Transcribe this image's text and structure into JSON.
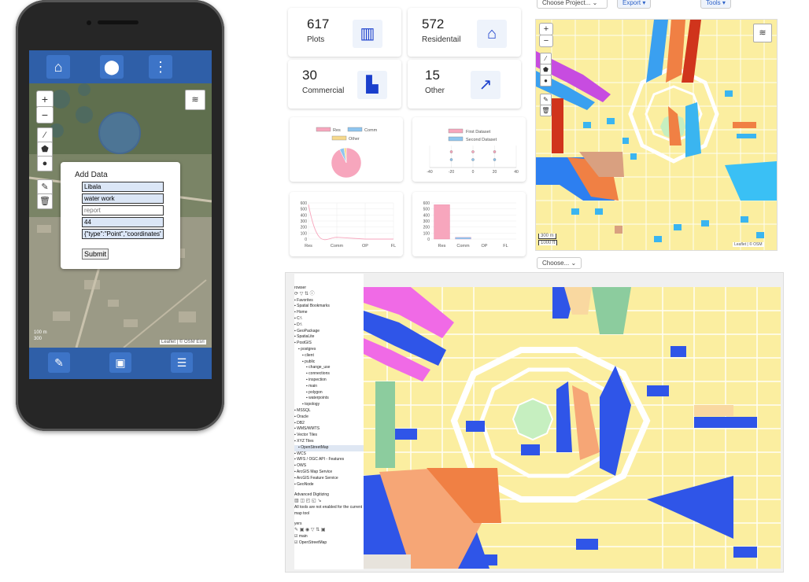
{
  "phone": {
    "form": {
      "title": "Add Data",
      "fields": [
        "Libala",
        "water work",
        "",
        "44",
        "{\"type\":\"Point\",\"coordinates\""
      ],
      "placeholder_report": "report",
      "submit_label": "Submit"
    },
    "map": {
      "zoom_in": "+",
      "zoom_out": "−",
      "scale_m": "100 m",
      "scale_ft": "300",
      "attribution": "Leaflet | © OSM  Esri"
    }
  },
  "dashboard": {
    "top_dropdowns": [
      "Choose Project...",
      "Export",
      "Tools"
    ],
    "stats": [
      {
        "value": "617",
        "label": "Plots"
      },
      {
        "value": "572",
        "label": "Residentail"
      },
      {
        "value": "30",
        "label": "Commercial"
      },
      {
        "value": "15",
        "label": "Other"
      }
    ],
    "bottom_dropdown": "Choose...",
    "map": {
      "zoom_in": "+",
      "zoom_out": "−",
      "scale_m": "300 m",
      "scale_ft": "1000 ft",
      "attribution": "Leaflet | © OSM"
    }
  },
  "chart_data": [
    {
      "type": "pie",
      "legend": [
        "Res",
        "Comm",
        "Other"
      ],
      "values": [
        572,
        30,
        15
      ],
      "colors": [
        "#f7a6bd",
        "#8ec5ef",
        "#f6d98c"
      ]
    },
    {
      "type": "scatter",
      "legend": [
        "First Dataset",
        "Second Dataset"
      ],
      "x_ticks": [
        "-40",
        "-20",
        "0",
        "20",
        "40"
      ],
      "series": [
        {
          "name": "First Dataset",
          "points": [
            [
              -20,
              1
            ],
            [
              0,
              1
            ],
            [
              20,
              1
            ]
          ]
        },
        {
          "name": "Second Dataset",
          "points": [
            [
              -20,
              0
            ],
            [
              0,
              0
            ],
            [
              20,
              0
            ]
          ]
        }
      ],
      "colors": [
        "#f7a6bd",
        "#8ec5ef"
      ]
    },
    {
      "type": "line",
      "categories": [
        "Res",
        "Comm",
        "OP",
        "FL"
      ],
      "y_ticks": [
        "600",
        "500",
        "400",
        "300",
        "200",
        "100",
        "0"
      ],
      "values": [
        572,
        30,
        0,
        0
      ],
      "ylim": [
        0,
        600
      ],
      "color": "#f7a6bd"
    },
    {
      "type": "bar",
      "categories": [
        "Res",
        "Comm",
        "OP",
        "FL"
      ],
      "y_ticks": [
        "600",
        "500",
        "400",
        "300",
        "200",
        "100",
        "0"
      ],
      "values": [
        572,
        30,
        0,
        0
      ],
      "ylim": [
        0,
        600
      ],
      "colors": [
        "#f7a6bd",
        "#8ec5ef",
        "#f6d98c",
        "#b9a6f0"
      ]
    }
  ],
  "qgis": {
    "browser_title": "rowser",
    "tree": [
      "Favorites",
      "Spatial Bookmarks",
      "Home",
      "C:\\",
      "D:\\",
      "GeoPackage",
      "SpatiaLite",
      "PostGIS",
      "postgres",
      "client",
      "public",
      "change_use",
      "connections",
      "inspection",
      "main",
      "polygon",
      "waterpoints",
      "topology",
      "MSSQL",
      "Oracle",
      "DB2",
      "WMS/WMTS",
      "Vector Tiles",
      "XYZ Tiles",
      "OpenStreetMap",
      "WCS",
      "WFS / OGC API - Features",
      "OWS",
      "ArcGIS Map Service",
      "ArcGIS Feature Service",
      "GeoNode"
    ],
    "digitizing_title": "Advanced Digitizing",
    "digitizing_msg": "All tools are not enabled for the current map tool",
    "layers_title": "yers",
    "layers": [
      "main",
      "OpenStreetMap"
    ]
  }
}
